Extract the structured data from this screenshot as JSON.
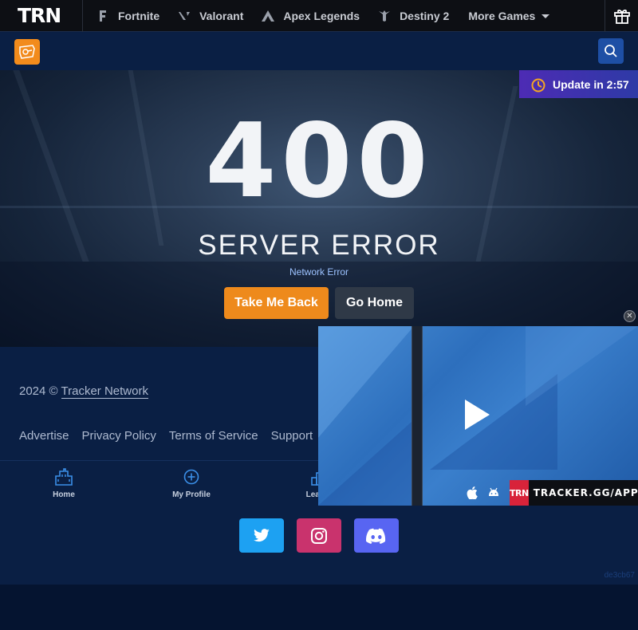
{
  "topnav": {
    "logo": "TRN",
    "games": [
      {
        "label": "Fortnite",
        "icon": "fortnite-icon"
      },
      {
        "label": "Valorant",
        "icon": "valorant-icon"
      },
      {
        "label": "Apex Legends",
        "icon": "apex-icon"
      },
      {
        "label": "Destiny 2",
        "icon": "destiny-icon"
      }
    ],
    "more_label": "More Games",
    "gift_icon": "gift-icon"
  },
  "subbar": {
    "game_logo_icon": "rocket-league-icon",
    "search_icon": "search-icon"
  },
  "badge": {
    "label": "Update in 2:57"
  },
  "error": {
    "code": "400",
    "title": "SERVER ERROR",
    "subtitle": "Network Error",
    "back_label": "Take Me Back",
    "home_label": "Go Home"
  },
  "footer": {
    "copyright_prefix": "2024 ©",
    "copyright_link": "Tracker Network",
    "links": [
      "Advertise",
      "Privacy Policy",
      "Terms of Service",
      "Support"
    ],
    "nav": [
      {
        "label": "Home",
        "icon": "city-icon"
      },
      {
        "label": "My Profile",
        "icon": "plus-circle-icon"
      },
      {
        "label": "Leader",
        "icon": "leaderboard-icon"
      }
    ],
    "social": [
      "twitter-icon",
      "instagram-icon",
      "discord-icon"
    ],
    "hash": "de3cb67"
  },
  "video": {
    "tag_logo": "TRN",
    "tag_url": "TRACKER.GG/APPS"
  },
  "colors": {
    "accent_orange": "#ee8a1c",
    "primary_blue": "#1e4fa5",
    "background": "#071a3a",
    "badge_purple": "#4d2bb4"
  }
}
